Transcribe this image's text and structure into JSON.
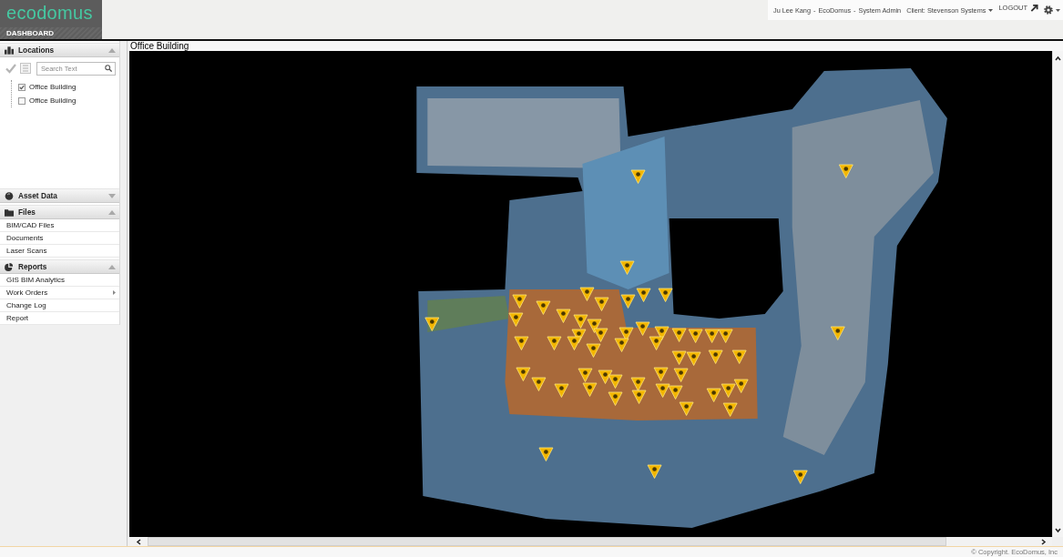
{
  "header": {
    "logo": "ecodomus",
    "nav": "DASHBOARD",
    "account": [
      "Ju Lee Kang",
      "-",
      "EcoDomus",
      "-",
      "System Admin"
    ],
    "client": "Client: Stevenson Systems",
    "logout": "LOGOUT"
  },
  "sidebar": {
    "panels": [
      {
        "title": "Locations",
        "expanded": true,
        "search": {
          "placeholder": "Search Text"
        },
        "tree": [
          {
            "label": "Office Building",
            "checked": true
          },
          {
            "label": "Office Building",
            "checked": false
          }
        ]
      },
      {
        "title": "Asset Data",
        "expanded": false
      },
      {
        "title": "Files",
        "expanded": true,
        "items": [
          {
            "label": "BIM/CAD Files",
            "submenu": false
          },
          {
            "label": "Documents",
            "submenu": false
          },
          {
            "label": "Laser Scans",
            "submenu": false
          }
        ]
      },
      {
        "title": "Reports",
        "expanded": true,
        "items": [
          {
            "label": "GIS BIM Analytics",
            "submenu": false
          },
          {
            "label": "Work Orders",
            "submenu": true
          },
          {
            "label": "Change Log",
            "submenu": false
          },
          {
            "label": "Report",
            "submenu": false
          }
        ]
      }
    ]
  },
  "viewer": {
    "title": "Office Building"
  },
  "footer": {
    "copyright": "© Copyright. EcoDomus, Inc"
  }
}
